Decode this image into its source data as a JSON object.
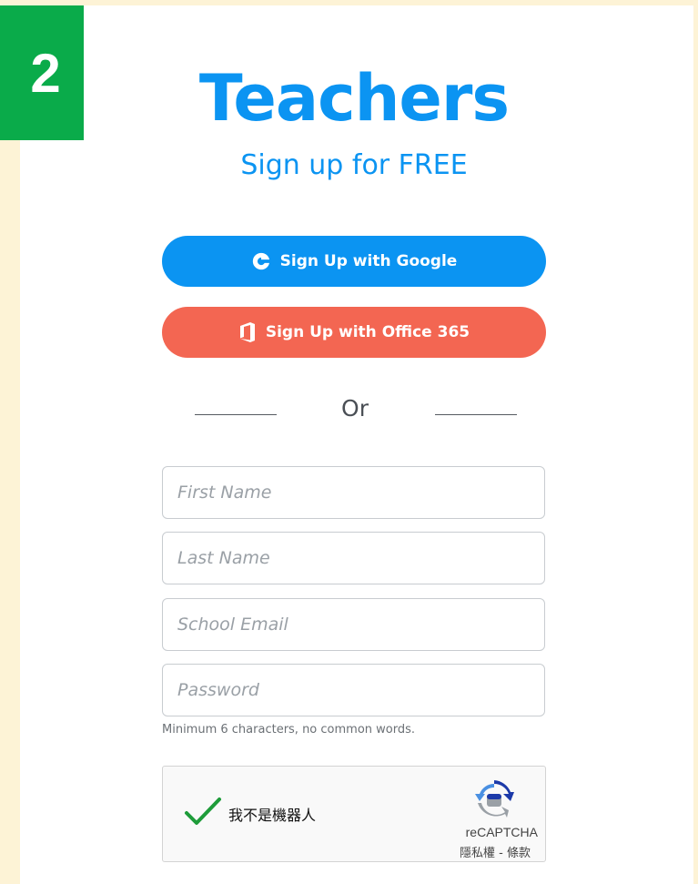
{
  "step": "2",
  "header": {
    "title": "Teachers",
    "subtitle": "Sign up for FREE"
  },
  "buttons": {
    "google_label": "Sign Up with Google",
    "office_label": "Sign Up with Office 365",
    "google_icon": "google-icon",
    "office_icon": "office-icon"
  },
  "divider": {
    "label": "Or"
  },
  "form": {
    "first_name_placeholder": "First Name",
    "last_name_placeholder": "Last Name",
    "email_placeholder": "School Email",
    "password_placeholder": "Password",
    "password_hint": "Minimum 6 characters, no common words."
  },
  "captcha": {
    "label": "我不是機器人",
    "brand": "reCAPTCHA",
    "privacy": "隱私權",
    "separator": " - ",
    "terms": "條款"
  },
  "colors": {
    "background": "#fdf3d6",
    "brand_blue": "#0b94f2",
    "office_red": "#f36652",
    "step_green": "#0aab4a",
    "check_green": "#1e9c3a"
  }
}
